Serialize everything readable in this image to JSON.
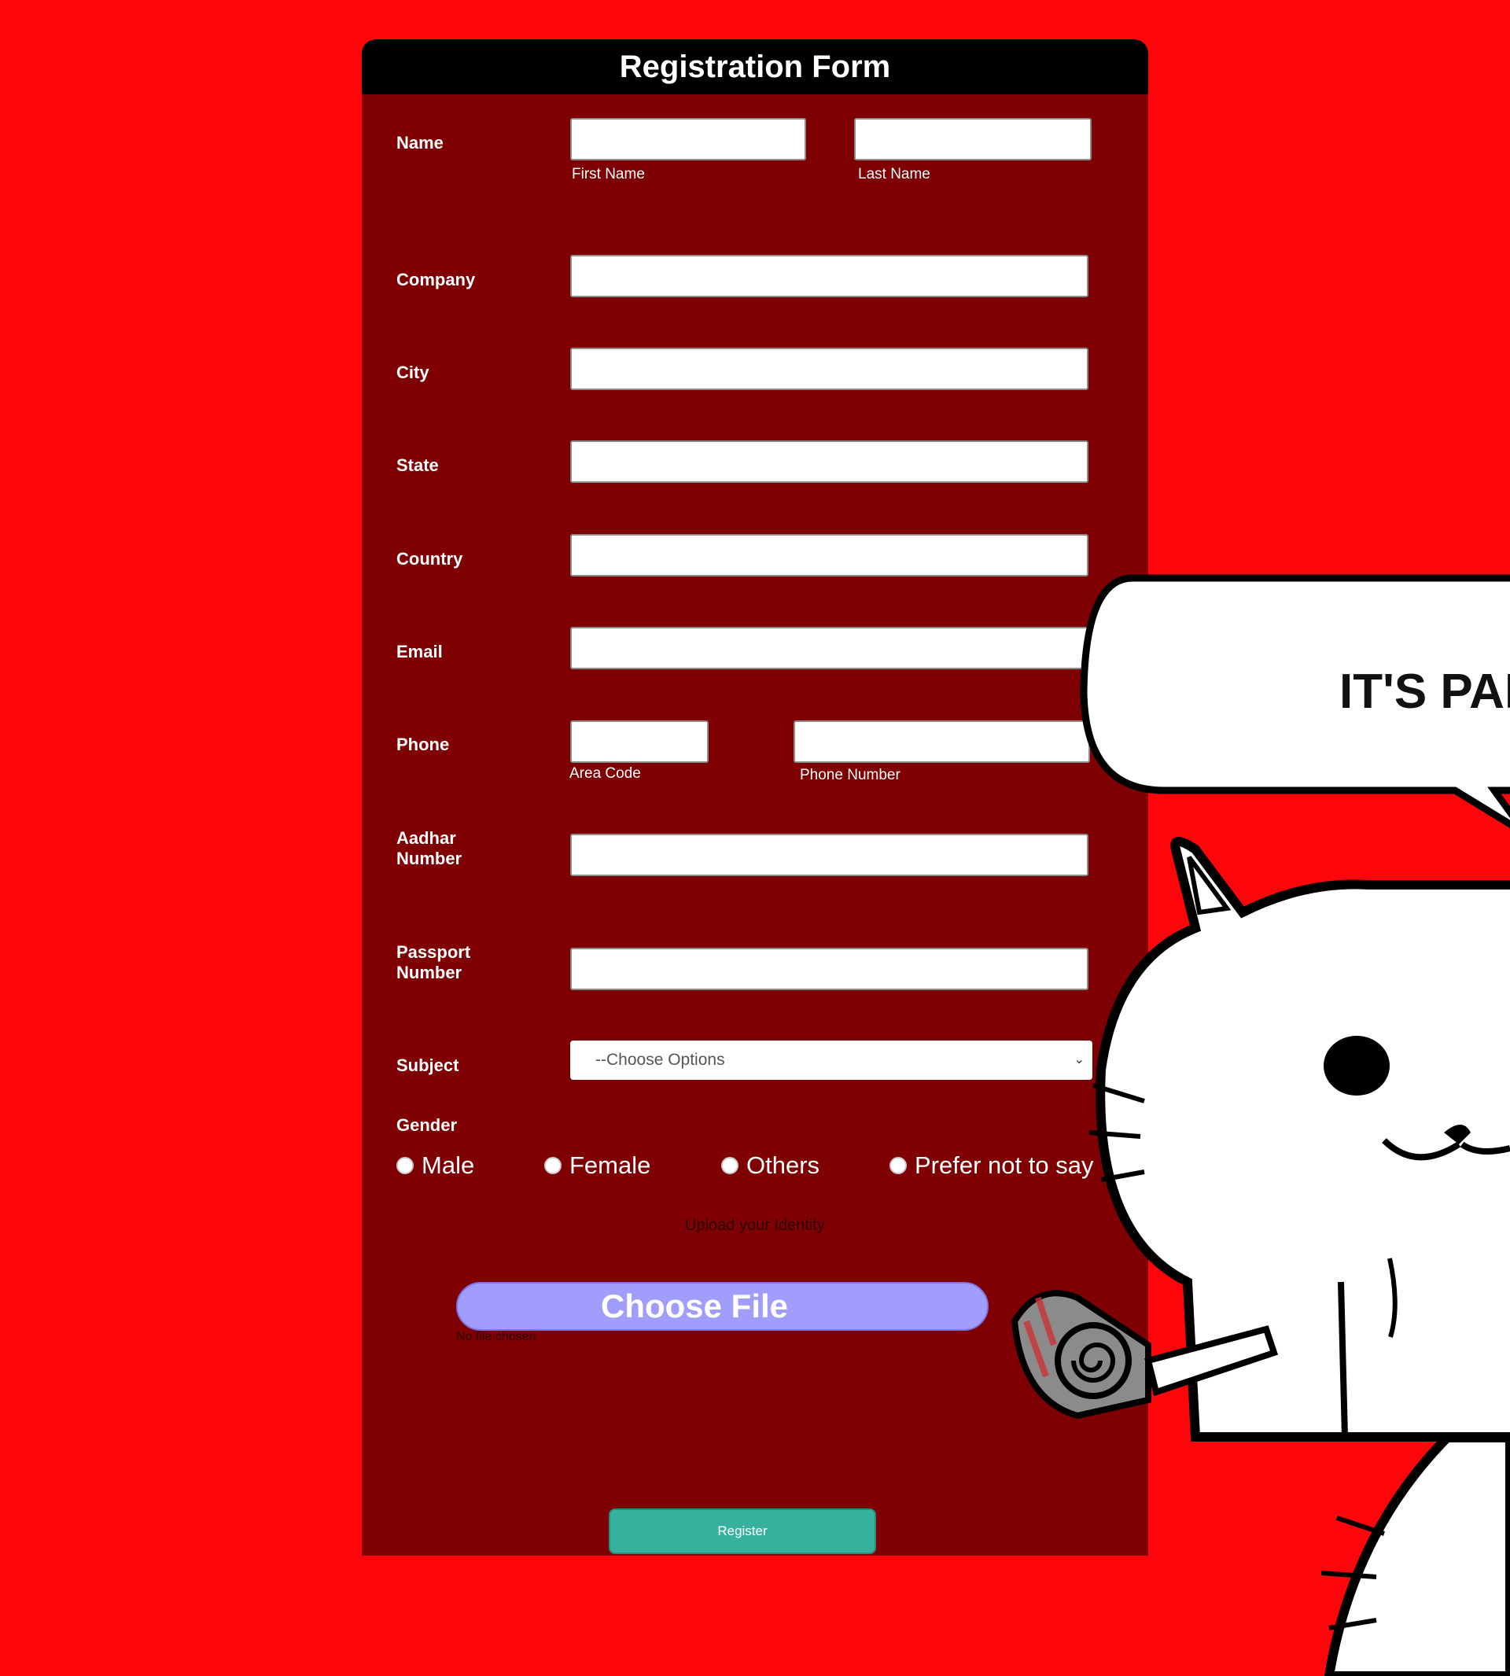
{
  "form": {
    "title": "Registration Form",
    "fields": {
      "name": {
        "label": "Name",
        "first_sub": "First Name",
        "last_sub": "Last Name"
      },
      "company": {
        "label": "Company"
      },
      "city": {
        "label": "City"
      },
      "state": {
        "label": "State"
      },
      "country": {
        "label": "Country"
      },
      "email": {
        "label": "Email"
      },
      "phone": {
        "label": "Phone",
        "area_sub": "Area Code",
        "number_sub": "Phone Number"
      },
      "aadhar": {
        "label_line1": "Aadhar",
        "label_line2": "Number"
      },
      "passport": {
        "label_line1": "Passport",
        "label_line2": "Number"
      },
      "subject": {
        "label": "Subject",
        "selected": "--Choose Options"
      },
      "gender": {
        "label": "Gender",
        "options": [
          "Male",
          "Female",
          "Others",
          "Prefer not to say"
        ]
      }
    },
    "upload": {
      "label": "Upload your Identity",
      "button": "Choose File",
      "status": "No file chosen"
    },
    "register_button": "Register"
  },
  "illustration": {
    "speech_text": "IT'S PAR"
  },
  "colors": {
    "background": "#fe050c",
    "card": "#7e0003",
    "header": "#000000",
    "choose_file": "#a19dfc",
    "register": "#38b09e"
  }
}
